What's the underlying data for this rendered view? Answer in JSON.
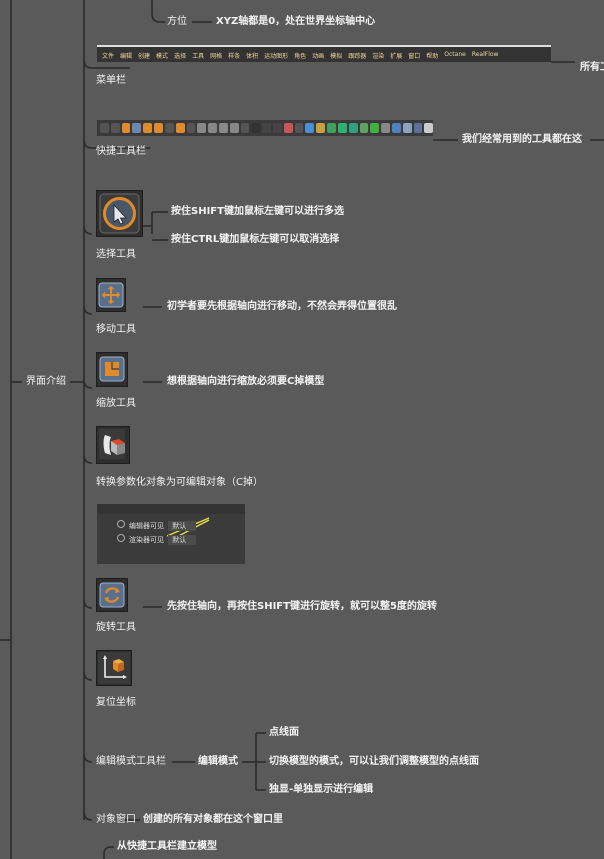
{
  "nodes": {
    "fangwei": "方位",
    "fangwei_desc": "XYZ轴都是0，处在世界坐标轴中心",
    "menubar": "菜单栏",
    "menubar_desc": "所有工",
    "quicktool": "快捷工具栏",
    "quicktool_desc": "我们经常用到的工具都在这",
    "select": "选择工具",
    "select_desc1": "按住SHIFT键加鼠标左键可以进行多选",
    "select_desc2": "按住CTRL键加鼠标左键可以取消选择",
    "move": "移动工具",
    "move_desc": "初学者要先根据轴向进行移动，不然会弄得位置很乱",
    "scale": "缩放工具",
    "scale_desc": "想根据轴向进行缩放必须要C掉模型",
    "convert": "转换参数化对象为可编辑对象（C掉）",
    "rotate": "旋转工具",
    "rotate_desc": "先按住轴向，再按住SHIFT键进行旋转，就可以整5度的旋转",
    "reset": "复位坐标",
    "edit_toolbar": "编辑模式工具栏",
    "edit_mode": "编辑模式",
    "edit_sub1": "点线面",
    "edit_sub2": "切换模型的模式，可以让我们调整模型的点线面",
    "edit_sub3": "独显-单独显示进行编辑",
    "object_window": "对象窗口",
    "object_window_desc": "创建的所有对象都在这个窗口里",
    "quick_build": "从快捷工具栏建立模型",
    "interface": "界面介绍"
  },
  "menu_items": [
    "文件",
    "编辑",
    "创建",
    "模式",
    "选择",
    "工具",
    "网格",
    "样条",
    "体积",
    "运动图形",
    "角色",
    "动画",
    "模拟",
    "跟踪器",
    "渲染",
    "扩展",
    "窗口",
    "帮助",
    "Octane",
    "RealFlow"
  ],
  "panel_rows": [
    {
      "label": "编辑器可见",
      "value": "默认"
    },
    {
      "label": "渲染器可见",
      "value": "默认"
    }
  ],
  "colors": {
    "background": "#5a5a5a",
    "line": "#2a2a2a",
    "text": "#f3f3f3",
    "accent": "#e08a2a"
  }
}
